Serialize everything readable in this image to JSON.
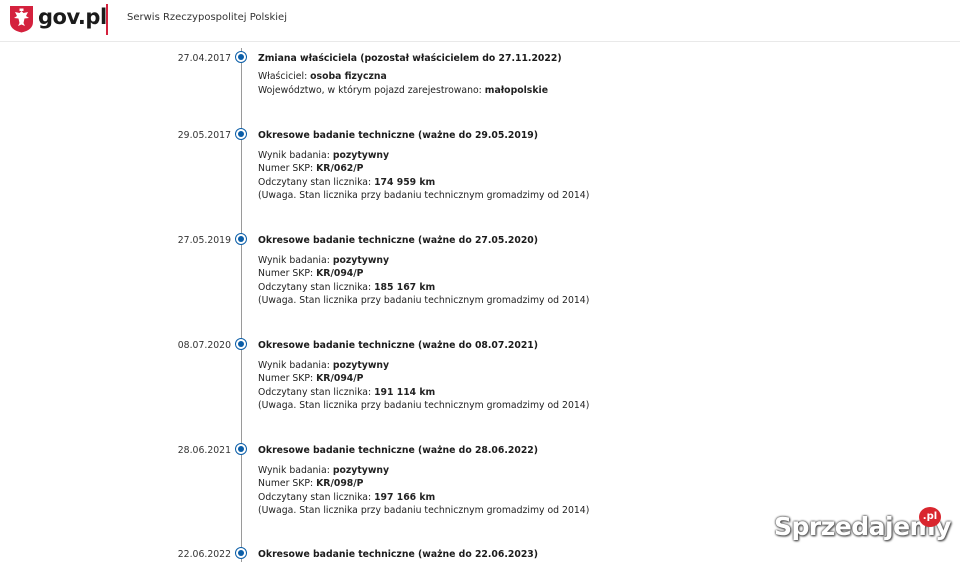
{
  "header": {
    "logo_text": "gov.pl",
    "service_name": "Serwis Rzeczypospolitej Polskiej"
  },
  "colors": {
    "accent_red": "#d4213d",
    "timeline_blue": "#0b5ea8"
  },
  "timeline": [
    {
      "date": "27.04.2017",
      "title": "Zmiana właściciela (pozostał właścicielem do 27.11.2022)",
      "lines": [
        {
          "label": "Właściciel: ",
          "value": "osoba fizyczna"
        },
        {
          "label": "Województwo, w którym pojazd zarejestrowano: ",
          "value": "małopolskie"
        }
      ]
    },
    {
      "date": "29.05.2017",
      "title": "Okresowe badanie techniczne (ważne do 29.05.2019)",
      "lines": [
        {
          "label": "Wynik badania: ",
          "value": "pozytywny"
        },
        {
          "label": "Numer SKP: ",
          "value": "KR/062/P"
        },
        {
          "label": "Odczytany stan licznika: ",
          "value": "174 959 km"
        },
        {
          "label": "(Uwaga. Stan licznika przy badaniu technicznym gromadzimy od 2014)",
          "value": ""
        }
      ]
    },
    {
      "date": "27.05.2019",
      "title": "Okresowe badanie techniczne (ważne do 27.05.2020)",
      "lines": [
        {
          "label": "Wynik badania: ",
          "value": "pozytywny"
        },
        {
          "label": "Numer SKP: ",
          "value": "KR/094/P"
        },
        {
          "label": "Odczytany stan licznika: ",
          "value": "185 167 km"
        },
        {
          "label": "(Uwaga. Stan licznika przy badaniu technicznym gromadzimy od 2014)",
          "value": ""
        }
      ]
    },
    {
      "date": "08.07.2020",
      "title": "Okresowe badanie techniczne (ważne do 08.07.2021)",
      "lines": [
        {
          "label": "Wynik badania: ",
          "value": "pozytywny"
        },
        {
          "label": "Numer SKP: ",
          "value": "KR/094/P"
        },
        {
          "label": "Odczytany stan licznika: ",
          "value": "191 114 km"
        },
        {
          "label": "(Uwaga. Stan licznika przy badaniu technicznym gromadzimy od 2014)",
          "value": ""
        }
      ]
    },
    {
      "date": "28.06.2021",
      "title": "Okresowe badanie techniczne (ważne do 28.06.2022)",
      "lines": [
        {
          "label": "Wynik badania: ",
          "value": "pozytywny"
        },
        {
          "label": "Numer SKP: ",
          "value": "KR/098/P"
        },
        {
          "label": "Odczytany stan licznika: ",
          "value": "197 166 km"
        },
        {
          "label": "(Uwaga. Stan licznika przy badaniu technicznym gromadzimy od 2014)",
          "value": ""
        }
      ]
    },
    {
      "date": "22.06.2022",
      "title": "Okresowe badanie techniczne (ważne do 22.06.2023)",
      "lines": []
    }
  ],
  "watermark": {
    "text": "Sprzedajemy",
    "badge": ".pl"
  }
}
